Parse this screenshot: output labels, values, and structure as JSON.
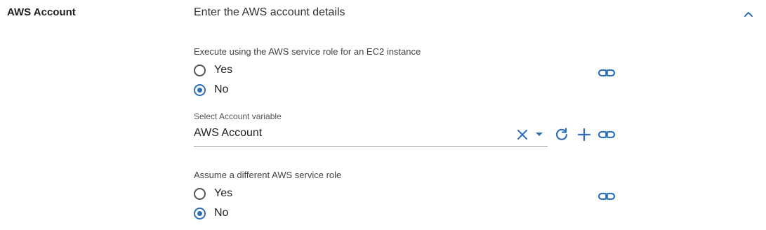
{
  "section": {
    "title": "AWS Account",
    "heading": "Enter the AWS account details",
    "collapse_icon": "chevron-up-icon"
  },
  "ec2_role": {
    "label": "Execute using the AWS service role for an EC2 instance",
    "options": [
      {
        "label": "Yes",
        "checked": false
      },
      {
        "label": "No",
        "checked": true
      }
    ],
    "link_icon": "link-icon"
  },
  "account_variable": {
    "label": "Select Account variable",
    "value": "AWS Account",
    "icons": [
      "clear-icon",
      "dropdown-arrow-icon",
      "refresh-icon",
      "add-icon",
      "link-icon"
    ]
  },
  "assume_role": {
    "label": "Assume a different AWS service role",
    "options": [
      {
        "label": "Yes",
        "checked": false
      },
      {
        "label": "No",
        "checked": true
      }
    ],
    "link_icon": "link-icon"
  },
  "colors": {
    "accent": "#2f6fb5",
    "text": "#1f1f1f",
    "divider": "#9e9e9e"
  }
}
